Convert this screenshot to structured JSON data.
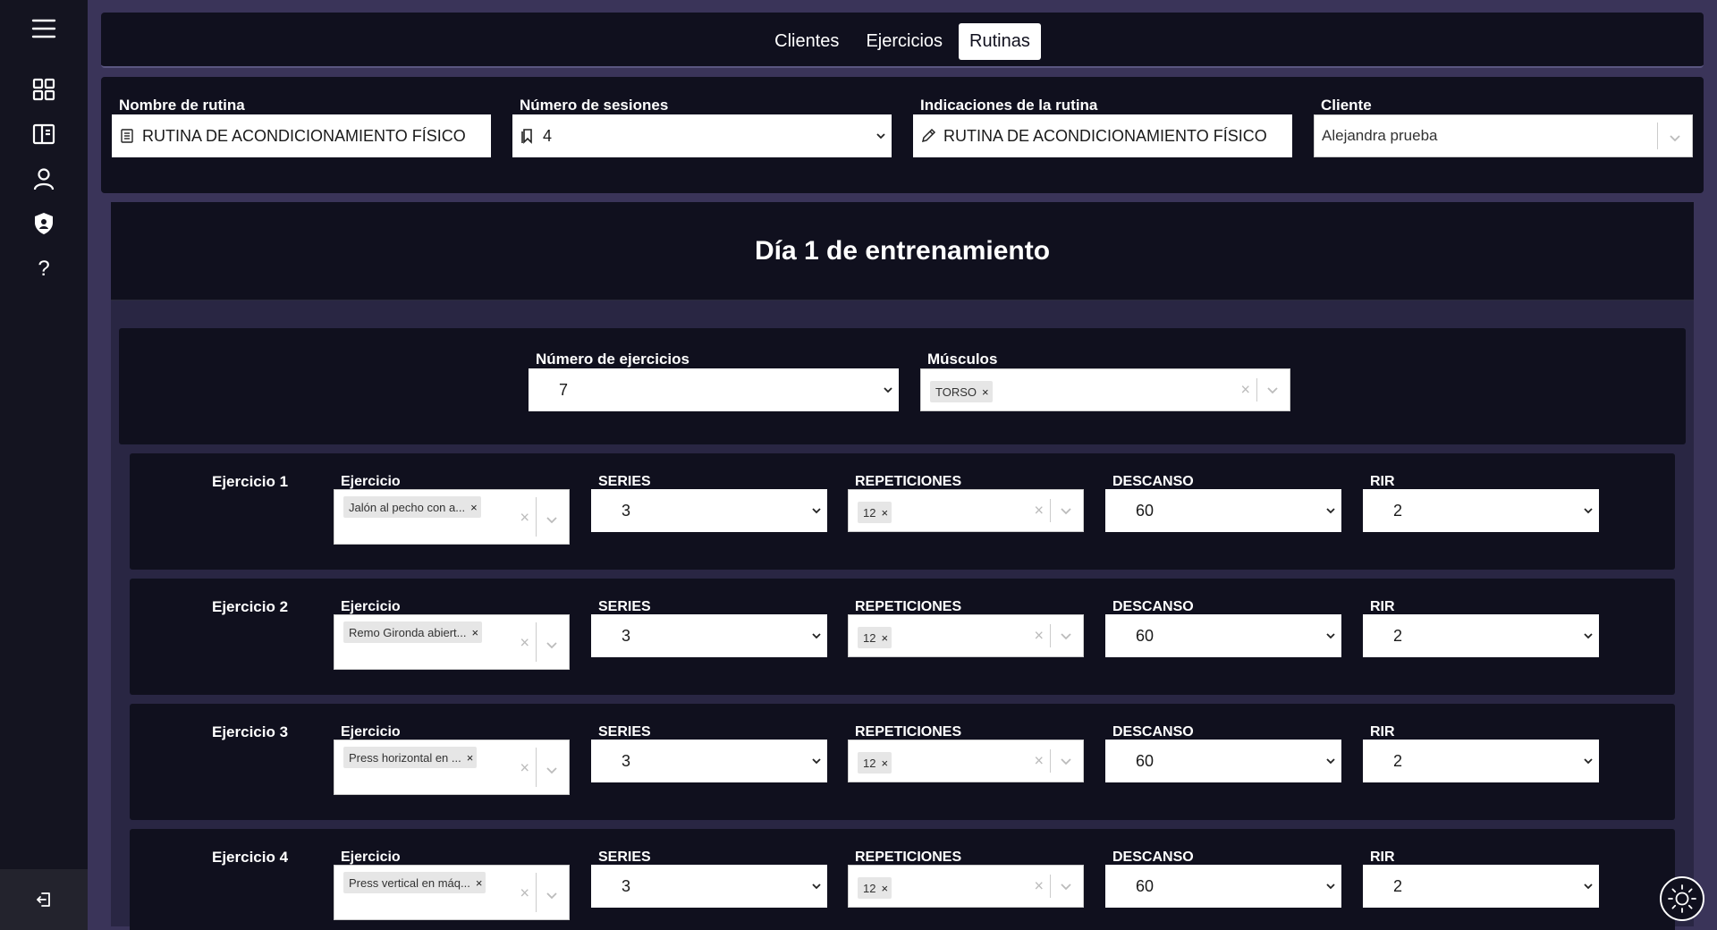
{
  "nav": {
    "tabs": [
      {
        "label": "Clientes",
        "active": false
      },
      {
        "label": "Ejercicios",
        "active": false
      },
      {
        "label": "Rutinas",
        "active": true
      }
    ]
  },
  "sidebar": {
    "icons": [
      "menu-icon",
      "dashboard-icon",
      "book-icon",
      "user-icon",
      "shield-icon",
      "help-icon"
    ],
    "logout_icon": "logout-icon"
  },
  "routine_form": {
    "name_label": "Nombre de rutina",
    "name_value": "RUTINA DE ACONDICIONAMIENTO FÍSICO",
    "sessions_label": "Número de sesiones",
    "sessions_value": "4",
    "notes_label": "Indicaciones de la rutina",
    "notes_value": "RUTINA DE ACONDICIONAMIENTO FÍSICO",
    "client_label": "Cliente",
    "client_value": "Alejandra prueba"
  },
  "day": {
    "title": "Día 1 de entrenamiento",
    "num_exercises_label": "Número de ejercicios",
    "num_exercises_value": "7",
    "muscles_label": "Músculos",
    "muscles_chip": "TORSO"
  },
  "column_labels": {
    "exercise": "Ejercicio",
    "series": "SERIES",
    "reps": "REPETICIONES",
    "rest": "DESCANSO",
    "rir": "RIR"
  },
  "exercises": [
    {
      "name": "Ejercicio 1",
      "exercise": "Jalón al pecho con a...",
      "series": "3",
      "reps": "12",
      "rest": "60",
      "rir": "2"
    },
    {
      "name": "Ejercicio 2",
      "exercise": "Remo Gironda abiert...",
      "series": "3",
      "reps": "12",
      "rest": "60",
      "rir": "2"
    },
    {
      "name": "Ejercicio 3",
      "exercise": "Press horizontal en ...",
      "series": "3",
      "reps": "12",
      "rest": "60",
      "rir": "2"
    },
    {
      "name": "Ejercicio 4",
      "exercise": "Press vertical en máq...",
      "series": "3",
      "reps": "12",
      "rest": "60",
      "rir": "2"
    }
  ],
  "theme_toggle_icon": "sun-icon",
  "colors": {
    "background": "#3a3459",
    "panel": "#10101e",
    "sidebar": "#141420",
    "accent": "#ffffff"
  }
}
